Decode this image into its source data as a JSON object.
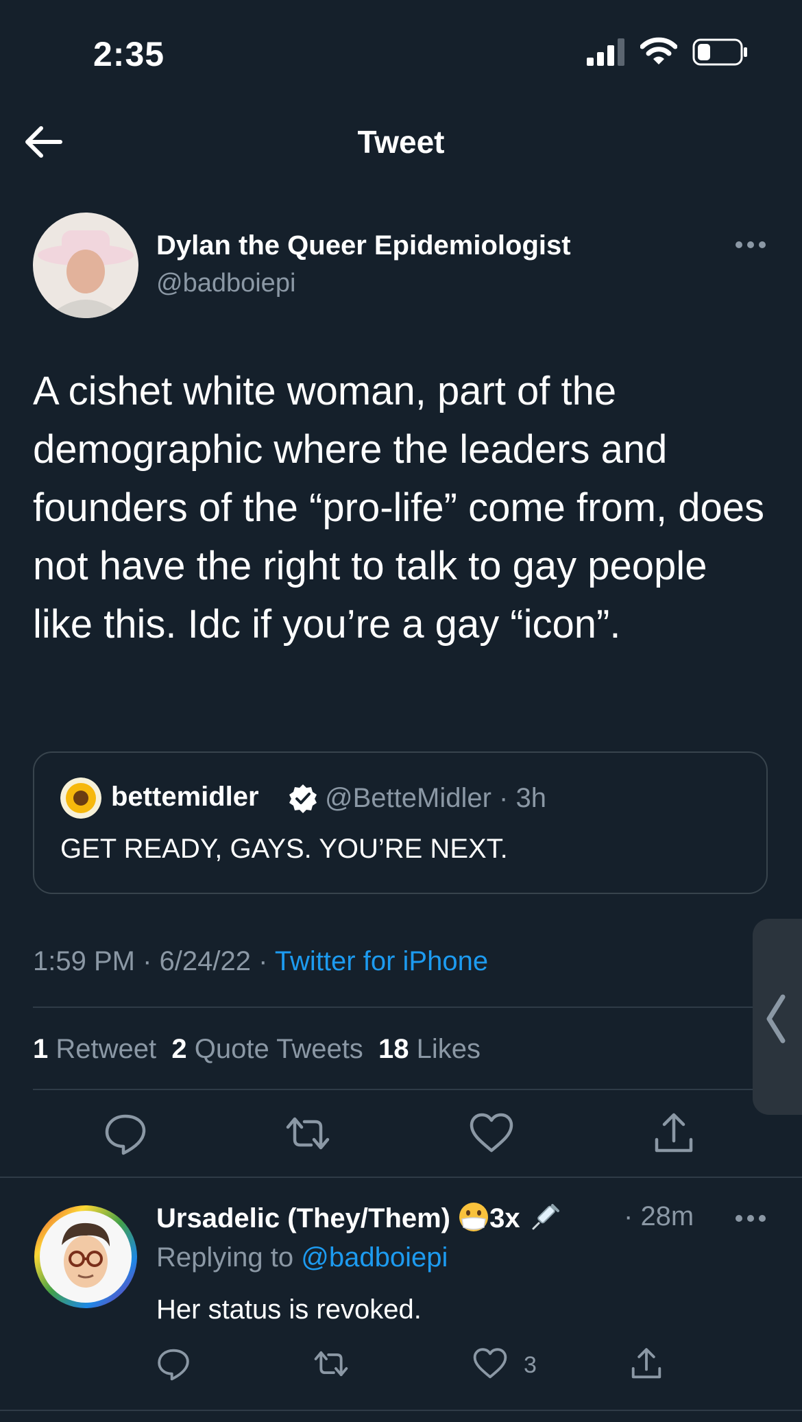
{
  "status_bar": {
    "time": "2:35"
  },
  "nav": {
    "title": "Tweet"
  },
  "tweet": {
    "author_name": "Dylan the Queer Epidemiologist",
    "author_handle": "@badboiepi",
    "text": "A cishet white woman, part of the demographic where the leaders and founders of the “pro-life” come from, does not have the right to talk to gay people like this. Idc if you’re a gay “icon”.",
    "time": "1:59 PM",
    "date": "6/24/22",
    "source": "Twitter for iPhone",
    "retweets_count": "1",
    "retweets_label": "Retweet",
    "quotes_count": "2",
    "quotes_label": "Quote Tweets",
    "likes_count": "18",
    "likes_label": "Likes"
  },
  "quoted": {
    "name": "bettemidler",
    "handle": "@BetteMidler",
    "age": "3h",
    "text": "GET READY, GAYS.  YOU’RE NEXT."
  },
  "reply": {
    "name": "Ursadelic (They/Them)",
    "name_suffix": "3x",
    "age": "28m",
    "replying_prefix": "Replying to",
    "replying_handle": "@badboiepi",
    "text": "Her status is revoked.",
    "like_count": "3"
  },
  "icons": [
    "back-arrow-icon",
    "more-icon",
    "verified-badge-icon",
    "reply-icon",
    "retweet-icon",
    "like-icon",
    "share-icon",
    "signal-icon",
    "wifi-icon",
    "battery-icon",
    "mask-emoji-icon",
    "syringe-emoji-icon",
    "sunflower-icon"
  ],
  "colors": {
    "background": "#15202b",
    "accent": "#1d9bf0",
    "muted": "#8b98a5",
    "border": "#38444d"
  }
}
